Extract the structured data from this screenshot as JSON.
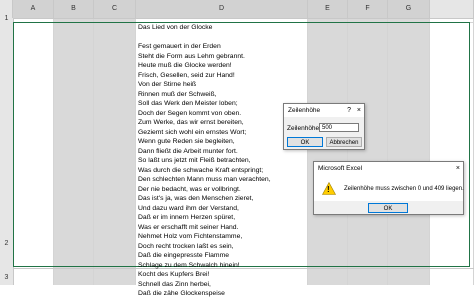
{
  "columns": [
    "A",
    "B",
    "C",
    "D",
    "E",
    "F",
    "G"
  ],
  "rows": [
    "1",
    "2",
    "3"
  ],
  "poem": [
    "Das Lied von der Glocke",
    "",
    "Fest gemauert in der Erden",
    "Steht die Form aus Lehm gebrannt.",
    "Heute muß die Glocke werden!",
    "Frisch, Gesellen, seid zur Hand!",
    "Von der Stirne heiß",
    "Rinnen muß der Schweiß,",
    "Soll das Werk den Meister loben;",
    "Doch der Segen kommt von oben.",
    "Zum Werke, das wir ernst bereiten,",
    "Geziemt sich wohl ein ernstes Wort;",
    "Wenn gute Reden sie begleiten,",
    "Dann fließt die Arbeit munter fort.",
    "So laßt uns jetzt mit Fleiß betrachten,",
    "Was durch die schwache Kraft entspringt;",
    "Den schlechten Mann muss man verachten,",
    "Der nie bedacht, was er vollbringt.",
    "Das ist's ja, was den Menschen zieret,",
    "Und dazu ward ihm der Verstand,",
    "Daß er im innern Herzen spüret,",
    "Was er erschafft mit seiner Hand.",
    "Nehmet Holz vom Fichtenstamme,",
    "Doch recht trocken laßt es sein,",
    "Daß die eingepresste Flamme",
    "Schlage zu dem Schwalch hinein!",
    "Kocht des Kupfers Brei!",
    "Schnell das Zinn herbei,",
    "Daß die zähe Glockenspeise"
  ],
  "row_height_dialog": {
    "title": "Zeilenhöhe",
    "close_glyph": "?",
    "close2_glyph": "×",
    "label": "Zeilenhöhe:",
    "value": "500",
    "ok_label": "OK",
    "cancel_label": "Abbrechen"
  },
  "error_dialog": {
    "title": "Microsoft Excel",
    "close_glyph": "×",
    "icon_glyph": "!",
    "message": "Zeilenhöhe muss zwischen 0 und 409 liegen.",
    "ok_label": "OK"
  },
  "colors": {
    "selection_border": "#217346",
    "header_bg": "#e6e6e6",
    "gray_fill": "#d9d9d9",
    "default_button_border": "#0078d7",
    "warning_yellow": "#ffcc00"
  }
}
